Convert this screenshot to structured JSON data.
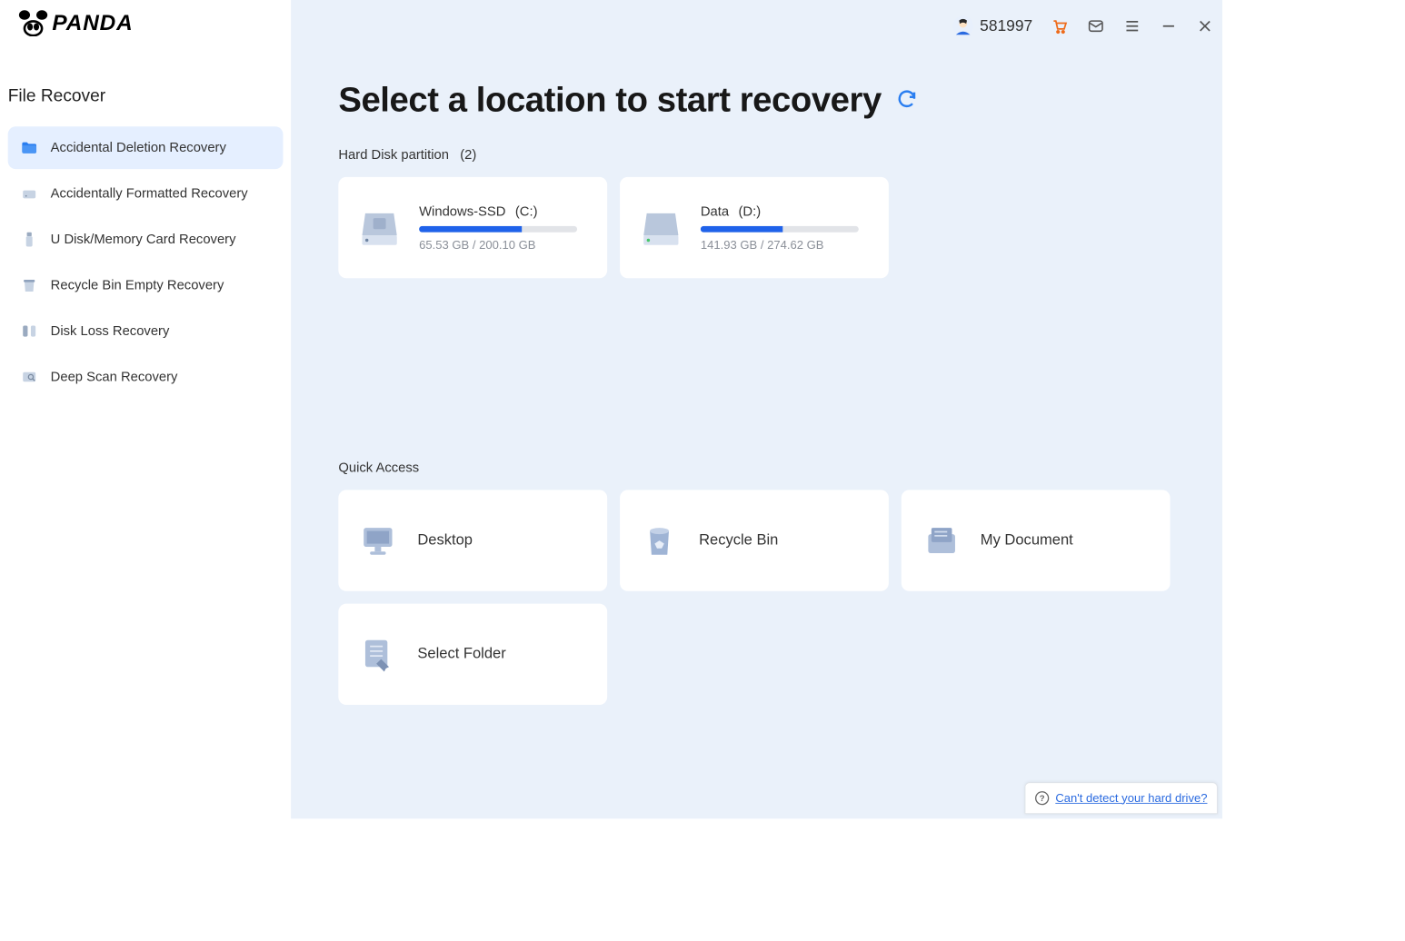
{
  "brand": "PANDA",
  "user_id": "581997",
  "sidebar": {
    "title": "File Recover",
    "items": [
      "Accidental Deletion Recovery",
      "Accidentally Formatted Recovery",
      "U Disk/Memory Card Recovery",
      "Recycle Bin Empty Recovery",
      "Disk Loss Recovery",
      "Deep Scan Recovery"
    ]
  },
  "page_title": "Select a location to start recovery",
  "partition_section": {
    "label": "Hard Disk partition",
    "count": "(2)"
  },
  "disks": [
    {
      "name": "Windows-SSD",
      "letter": "(C:)",
      "usage": "65.53 GB / 200.10 GB",
      "pct": 65
    },
    {
      "name": "Data",
      "letter": "(D:)",
      "usage": "141.93 GB / 274.62 GB",
      "pct": 52
    }
  ],
  "quick_section": "Quick Access",
  "quick": [
    "Desktop",
    "Recycle Bin",
    "My Document",
    "Select Folder"
  ],
  "help_text": "Can't detect your hard drive?"
}
